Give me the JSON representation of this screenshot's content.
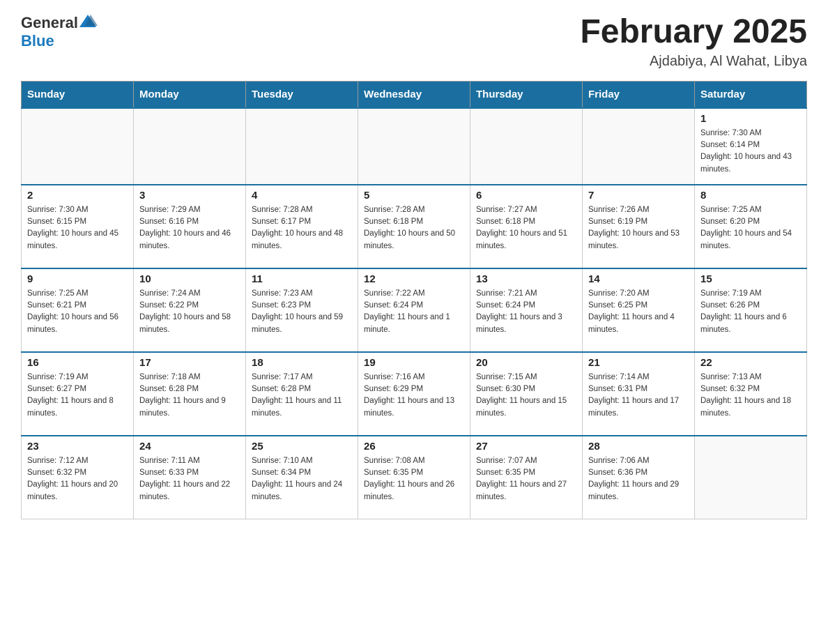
{
  "header": {
    "logo_general": "General",
    "logo_blue": "Blue",
    "title": "February 2025",
    "subtitle": "Ajdabiya, Al Wahat, Libya"
  },
  "days_of_week": [
    "Sunday",
    "Monday",
    "Tuesday",
    "Wednesday",
    "Thursday",
    "Friday",
    "Saturday"
  ],
  "weeks": [
    [
      {
        "day": "",
        "sunrise": "",
        "sunset": "",
        "daylight": ""
      },
      {
        "day": "",
        "sunrise": "",
        "sunset": "",
        "daylight": ""
      },
      {
        "day": "",
        "sunrise": "",
        "sunset": "",
        "daylight": ""
      },
      {
        "day": "",
        "sunrise": "",
        "sunset": "",
        "daylight": ""
      },
      {
        "day": "",
        "sunrise": "",
        "sunset": "",
        "daylight": ""
      },
      {
        "day": "",
        "sunrise": "",
        "sunset": "",
        "daylight": ""
      },
      {
        "day": "1",
        "sunrise": "Sunrise: 7:30 AM",
        "sunset": "Sunset: 6:14 PM",
        "daylight": "Daylight: 10 hours and 43 minutes."
      }
    ],
    [
      {
        "day": "2",
        "sunrise": "Sunrise: 7:30 AM",
        "sunset": "Sunset: 6:15 PM",
        "daylight": "Daylight: 10 hours and 45 minutes."
      },
      {
        "day": "3",
        "sunrise": "Sunrise: 7:29 AM",
        "sunset": "Sunset: 6:16 PM",
        "daylight": "Daylight: 10 hours and 46 minutes."
      },
      {
        "day": "4",
        "sunrise": "Sunrise: 7:28 AM",
        "sunset": "Sunset: 6:17 PM",
        "daylight": "Daylight: 10 hours and 48 minutes."
      },
      {
        "day": "5",
        "sunrise": "Sunrise: 7:28 AM",
        "sunset": "Sunset: 6:18 PM",
        "daylight": "Daylight: 10 hours and 50 minutes."
      },
      {
        "day": "6",
        "sunrise": "Sunrise: 7:27 AM",
        "sunset": "Sunset: 6:18 PM",
        "daylight": "Daylight: 10 hours and 51 minutes."
      },
      {
        "day": "7",
        "sunrise": "Sunrise: 7:26 AM",
        "sunset": "Sunset: 6:19 PM",
        "daylight": "Daylight: 10 hours and 53 minutes."
      },
      {
        "day": "8",
        "sunrise": "Sunrise: 7:25 AM",
        "sunset": "Sunset: 6:20 PM",
        "daylight": "Daylight: 10 hours and 54 minutes."
      }
    ],
    [
      {
        "day": "9",
        "sunrise": "Sunrise: 7:25 AM",
        "sunset": "Sunset: 6:21 PM",
        "daylight": "Daylight: 10 hours and 56 minutes."
      },
      {
        "day": "10",
        "sunrise": "Sunrise: 7:24 AM",
        "sunset": "Sunset: 6:22 PM",
        "daylight": "Daylight: 10 hours and 58 minutes."
      },
      {
        "day": "11",
        "sunrise": "Sunrise: 7:23 AM",
        "sunset": "Sunset: 6:23 PM",
        "daylight": "Daylight: 10 hours and 59 minutes."
      },
      {
        "day": "12",
        "sunrise": "Sunrise: 7:22 AM",
        "sunset": "Sunset: 6:24 PM",
        "daylight": "Daylight: 11 hours and 1 minute."
      },
      {
        "day": "13",
        "sunrise": "Sunrise: 7:21 AM",
        "sunset": "Sunset: 6:24 PM",
        "daylight": "Daylight: 11 hours and 3 minutes."
      },
      {
        "day": "14",
        "sunrise": "Sunrise: 7:20 AM",
        "sunset": "Sunset: 6:25 PM",
        "daylight": "Daylight: 11 hours and 4 minutes."
      },
      {
        "day": "15",
        "sunrise": "Sunrise: 7:19 AM",
        "sunset": "Sunset: 6:26 PM",
        "daylight": "Daylight: 11 hours and 6 minutes."
      }
    ],
    [
      {
        "day": "16",
        "sunrise": "Sunrise: 7:19 AM",
        "sunset": "Sunset: 6:27 PM",
        "daylight": "Daylight: 11 hours and 8 minutes."
      },
      {
        "day": "17",
        "sunrise": "Sunrise: 7:18 AM",
        "sunset": "Sunset: 6:28 PM",
        "daylight": "Daylight: 11 hours and 9 minutes."
      },
      {
        "day": "18",
        "sunrise": "Sunrise: 7:17 AM",
        "sunset": "Sunset: 6:28 PM",
        "daylight": "Daylight: 11 hours and 11 minutes."
      },
      {
        "day": "19",
        "sunrise": "Sunrise: 7:16 AM",
        "sunset": "Sunset: 6:29 PM",
        "daylight": "Daylight: 11 hours and 13 minutes."
      },
      {
        "day": "20",
        "sunrise": "Sunrise: 7:15 AM",
        "sunset": "Sunset: 6:30 PM",
        "daylight": "Daylight: 11 hours and 15 minutes."
      },
      {
        "day": "21",
        "sunrise": "Sunrise: 7:14 AM",
        "sunset": "Sunset: 6:31 PM",
        "daylight": "Daylight: 11 hours and 17 minutes."
      },
      {
        "day": "22",
        "sunrise": "Sunrise: 7:13 AM",
        "sunset": "Sunset: 6:32 PM",
        "daylight": "Daylight: 11 hours and 18 minutes."
      }
    ],
    [
      {
        "day": "23",
        "sunrise": "Sunrise: 7:12 AM",
        "sunset": "Sunset: 6:32 PM",
        "daylight": "Daylight: 11 hours and 20 minutes."
      },
      {
        "day": "24",
        "sunrise": "Sunrise: 7:11 AM",
        "sunset": "Sunset: 6:33 PM",
        "daylight": "Daylight: 11 hours and 22 minutes."
      },
      {
        "day": "25",
        "sunrise": "Sunrise: 7:10 AM",
        "sunset": "Sunset: 6:34 PM",
        "daylight": "Daylight: 11 hours and 24 minutes."
      },
      {
        "day": "26",
        "sunrise": "Sunrise: 7:08 AM",
        "sunset": "Sunset: 6:35 PM",
        "daylight": "Daylight: 11 hours and 26 minutes."
      },
      {
        "day": "27",
        "sunrise": "Sunrise: 7:07 AM",
        "sunset": "Sunset: 6:35 PM",
        "daylight": "Daylight: 11 hours and 27 minutes."
      },
      {
        "day": "28",
        "sunrise": "Sunrise: 7:06 AM",
        "sunset": "Sunset: 6:36 PM",
        "daylight": "Daylight: 11 hours and 29 minutes."
      },
      {
        "day": "",
        "sunrise": "",
        "sunset": "",
        "daylight": ""
      }
    ]
  ]
}
